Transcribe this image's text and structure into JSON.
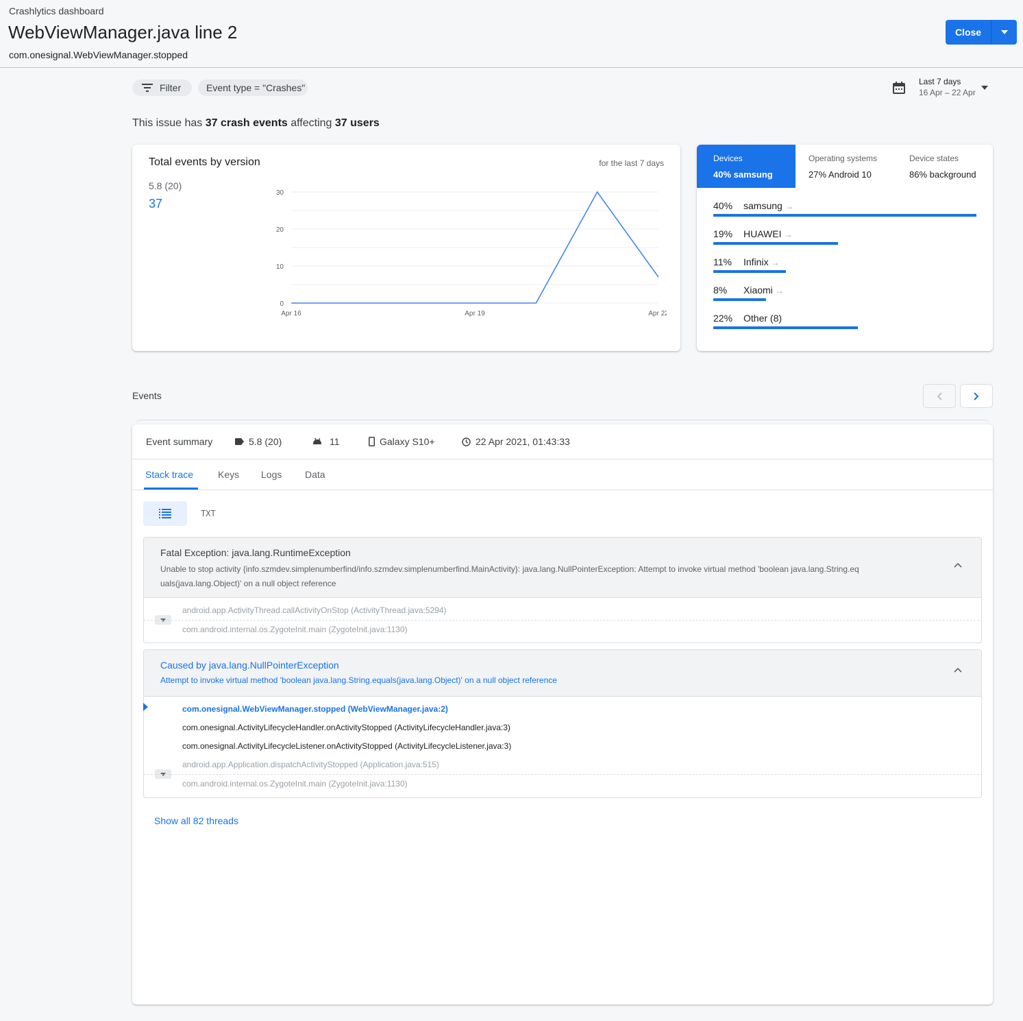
{
  "header": {
    "breadcrumb": "Crashlytics dashboard",
    "title": "WebViewManager.java line 2",
    "subtitle": "com.onesignal.WebViewManager.stopped",
    "close_label": "Close"
  },
  "filters": {
    "filter_label": "Filter",
    "event_type_chip": "Event type = \"Crashes\"",
    "date_range_label": "Last 7 days",
    "date_range_sub": "16 Apr – 22 Apr"
  },
  "summary": {
    "prefix": "This issue has ",
    "events": "37 crash events",
    "middle": " affecting ",
    "users": "37 users"
  },
  "chart_card": {
    "title": "Total events by version",
    "note": "for the last 7 days",
    "version_label": "5.8 (20)",
    "version_value": "37"
  },
  "chart_data": {
    "type": "line",
    "x": [
      "Apr 16",
      "Apr 17",
      "Apr 18",
      "Apr 19",
      "Apr 20",
      "Apr 21",
      "Apr 22"
    ],
    "xticks": [
      "Apr 16",
      "Apr 19",
      "Apr 22"
    ],
    "yticks": [
      "0",
      "10",
      "20",
      "30"
    ],
    "series": [
      {
        "name": "5.8 (20)",
        "values": [
          0,
          0,
          0,
          0,
          0,
          30,
          7
        ]
      }
    ],
    "ylim": [
      0,
      30
    ],
    "grid": true,
    "color": "#4285f4"
  },
  "distribution": {
    "tabs": [
      {
        "label": "Devices",
        "value": "40% samsung"
      },
      {
        "label": "Operating systems",
        "value": "27% Android 10"
      },
      {
        "label": "Device states",
        "value": "86% background"
      }
    ],
    "rows": [
      {
        "pct": "40%",
        "name": "samsung",
        "share": 0.4,
        "arrow": true
      },
      {
        "pct": "19%",
        "name": "HUAWEI",
        "share": 0.19,
        "arrow": true
      },
      {
        "pct": "11%",
        "name": "Infinix",
        "share": 0.11,
        "arrow": true
      },
      {
        "pct": "8%",
        "name": "Xiaomi",
        "share": 0.08,
        "arrow": true
      },
      {
        "pct": "22%",
        "name": "Other (8)",
        "share": 0.22,
        "arrow": false
      }
    ],
    "arrow_glyph": "→"
  },
  "events": {
    "label": "Events",
    "summary_label": "Event summary",
    "version": "5.8 (20)",
    "os_version": "11",
    "device": "Galaxy S10+",
    "timestamp": "22 Apr 2021, 01:43:33",
    "tabs": [
      "Stack trace",
      "Keys",
      "Logs",
      "Data"
    ],
    "view_txt": "TXT",
    "exceptions": [
      {
        "title": "Fatal Exception: java.lang.RuntimeException",
        "message": "Unable to stop activity {info.szmdev.simplenumberfind/info.szmdev.simplenumberfind.MainActivity}: java.lang.NullPointerException: Attempt to invoke virtual method 'boolean java.lang.String.eq uals(java.lang.Object)' on a null object reference",
        "frames": [
          "android.app.ActivityThread.callActivityOnStop (ActivityThread.java:5294)",
          "com.android.internal.os.ZygoteInit.main (ZygoteInit.java:1130)"
        ]
      },
      {
        "title": "Caused by java.lang.NullPointerException",
        "message": "Attempt to invoke virtual method 'boolean java.lang.String.equals(java.lang.Object)' on a null object reference",
        "frames": [
          "com.onesignal.WebViewManager.stopped (WebViewManager.java:2)",
          "com.onesignal.ActivityLifecycleHandler.onActivityStopped (ActivityLifecycleHandler.java:3)",
          "com.onesignal.ActivityLifecycleListener.onActivityStopped (ActivityLifecycleListener.java:3)",
          "android.app.Application.dispatchActivityStopped (Application.java:515)",
          "com.android.internal.os.ZygoteInit.main (ZygoteInit.java:1130)"
        ]
      }
    ],
    "show_threads": "Show all 82 threads"
  }
}
